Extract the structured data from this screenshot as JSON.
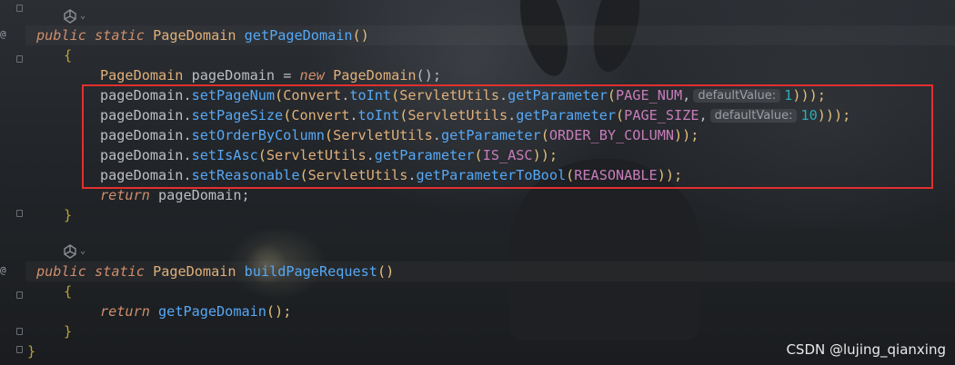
{
  "code": {
    "line1": {
      "kw1": "public",
      "kw2": "static",
      "type": "PageDomain",
      "fn": "getPageDomain",
      "parens": "()"
    },
    "line2": {
      "brace": "{"
    },
    "line3": {
      "type": "PageDomain",
      "var": "pageDomain",
      "eq": "=",
      "kw": "new",
      "ctor": "PageDomain",
      "end": "();"
    },
    "line4": {
      "obj": "pageDomain",
      "dot1": ".",
      "m": "setPageNum",
      "p1": "(",
      "cls": "Convert",
      "dot2": ".",
      "m2": "toInt",
      "p2": "(",
      "cls2": "ServletUtils",
      "dot3": ".",
      "m3": "getParameter",
      "p3": "(",
      "const": "PAGE_NUM",
      "comma": ",",
      "hint": "defaultValue:",
      "num": "1",
      "end": ")));"
    },
    "line5": {
      "obj": "pageDomain",
      "dot1": ".",
      "m": "setPageSize",
      "p1": "(",
      "cls": "Convert",
      "dot2": ".",
      "m2": "toInt",
      "p2": "(",
      "cls2": "ServletUtils",
      "dot3": ".",
      "m3": "getParameter",
      "p3": "(",
      "const": "PAGE_SIZE",
      "comma": ",",
      "hint": "defaultValue:",
      "num": "10",
      "end": ")));"
    },
    "line6": {
      "obj": "pageDomain",
      "dot1": ".",
      "m": "setOrderByColumn",
      "p1": "(",
      "cls2": "ServletUtils",
      "dot3": ".",
      "m3": "getParameter",
      "p3": "(",
      "const": "ORDER_BY_COLUMN",
      "end": "));"
    },
    "line7": {
      "obj": "pageDomain",
      "dot1": ".",
      "m": "setIsAsc",
      "p1": "(",
      "cls2": "ServletUtils",
      "dot3": ".",
      "m3": "getParameter",
      "p3": "(",
      "const": "IS_ASC",
      "end": "));"
    },
    "line8": {
      "obj": "pageDomain",
      "dot1": ".",
      "m": "setReasonable",
      "p1": "(",
      "cls2": "ServletUtils",
      "dot3": ".",
      "m3": "getParameterToBool",
      "p3": "(",
      "const": "REASONABLE",
      "end": "));"
    },
    "line9": {
      "kw": "return",
      "var": "pageDomain",
      "end": ";"
    },
    "line10": {
      "brace": "}"
    },
    "line11": {
      "kw1": "public",
      "kw2": "static",
      "type": "PageDomain",
      "fn": "buildPageRequest",
      "parens": "()"
    },
    "line12": {
      "brace": "{"
    },
    "line13": {
      "kw": "return",
      "fn": "getPageDomain",
      "end": "();"
    },
    "line14": {
      "brace": "}"
    },
    "line15": {
      "brace": "}"
    }
  },
  "gutter": {
    "mark": "@"
  },
  "watermark": "CSDN @lujing_qianxing",
  "colors": {
    "keyword": "#cf8e6d",
    "type": "#e0b07a",
    "method": "#56a8f5",
    "constant": "#c77dbb",
    "number": "#2aacb8",
    "highlight_box": "#e2302f"
  },
  "icons": {
    "codelens": "ai-codelens-icon",
    "caret": "chevron-down-icon",
    "fold": "fold-marker-icon",
    "gutter": "override-marker-icon"
  }
}
